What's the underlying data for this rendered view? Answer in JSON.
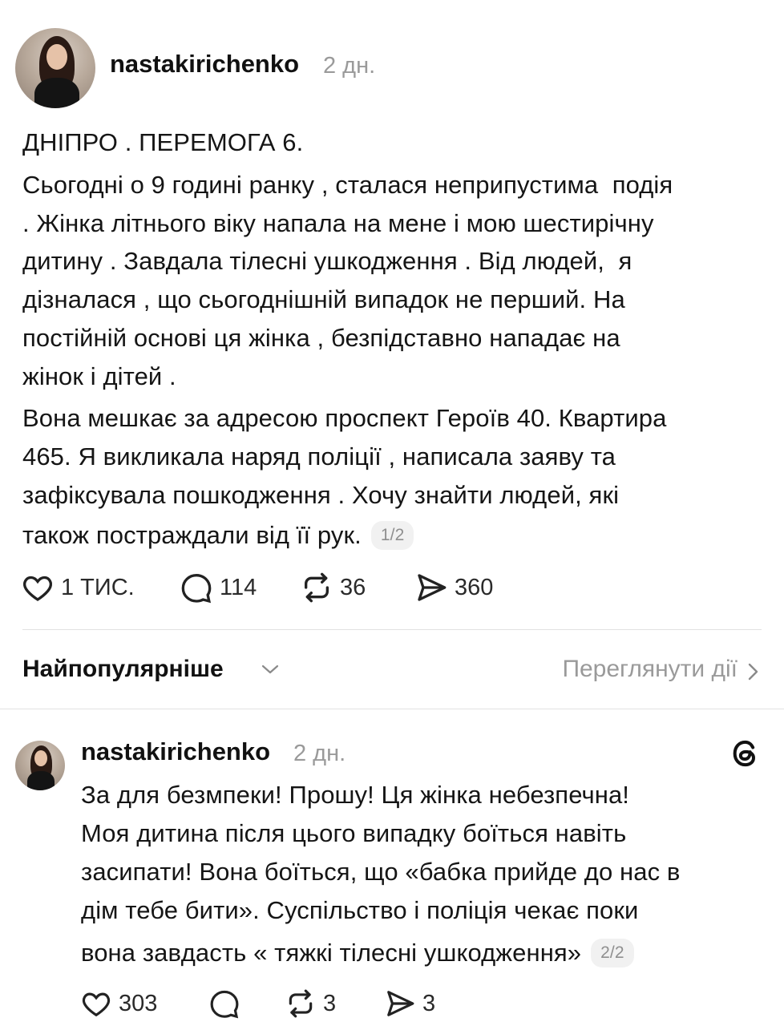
{
  "post": {
    "username": "nastakirichenko",
    "time": "2 дн.",
    "lines": [
      "ДНІПРО . ПЕРЕМОГА 6.",
      "Сьогодні о 9 годині ранку , сталася неприпустима  подія",
      ". Жінка літнього віку напала на мене і мою шестирічну",
      "дитину . Завдала тілесні ушкодження . Від людей,  я",
      "дізналася , що сьогоднішній випадок не перший. На",
      "постійній основі ця жінка , безпідставно нападає на",
      "жінок і дітей .",
      "Вона мешкає за адресою проспект Героїв 40. Квартира",
      "465. Я викликала наряд поліції , написала заяву та",
      "зафіксувала пошкодження . Хочу знайти людей, які",
      "також постраждали від її рук."
    ],
    "page_badge": "1/2",
    "actions": {
      "likes": "1 ТИС.",
      "comments": "114",
      "reposts": "36",
      "shares": "360"
    }
  },
  "sort": {
    "label": "Найпопулярніше",
    "view_activity": "Переглянути дії"
  },
  "reply": {
    "username": "nastakirichenko",
    "time": "2 дн.",
    "lines": [
      "За для безмпеки! Прошу! Ця жінка небезпечна!",
      "Моя дитина після цього випадку боїться навіть",
      "засипати! Вона боїться, що «бабка прийде до нас в",
      "дім тебе бити». Суспільство і поліція чекає поки",
      "вона завдасть « тяжкі тілесні ушкодження»"
    ],
    "page_badge": "2/2",
    "actions": {
      "likes": "303",
      "comments": "",
      "reposts": "3",
      "shares": "3"
    }
  },
  "icons": {
    "like": "heart-icon",
    "comment": "comment-icon",
    "repost": "repost-icon",
    "share": "share-icon",
    "threads": "threads-logo-icon"
  }
}
